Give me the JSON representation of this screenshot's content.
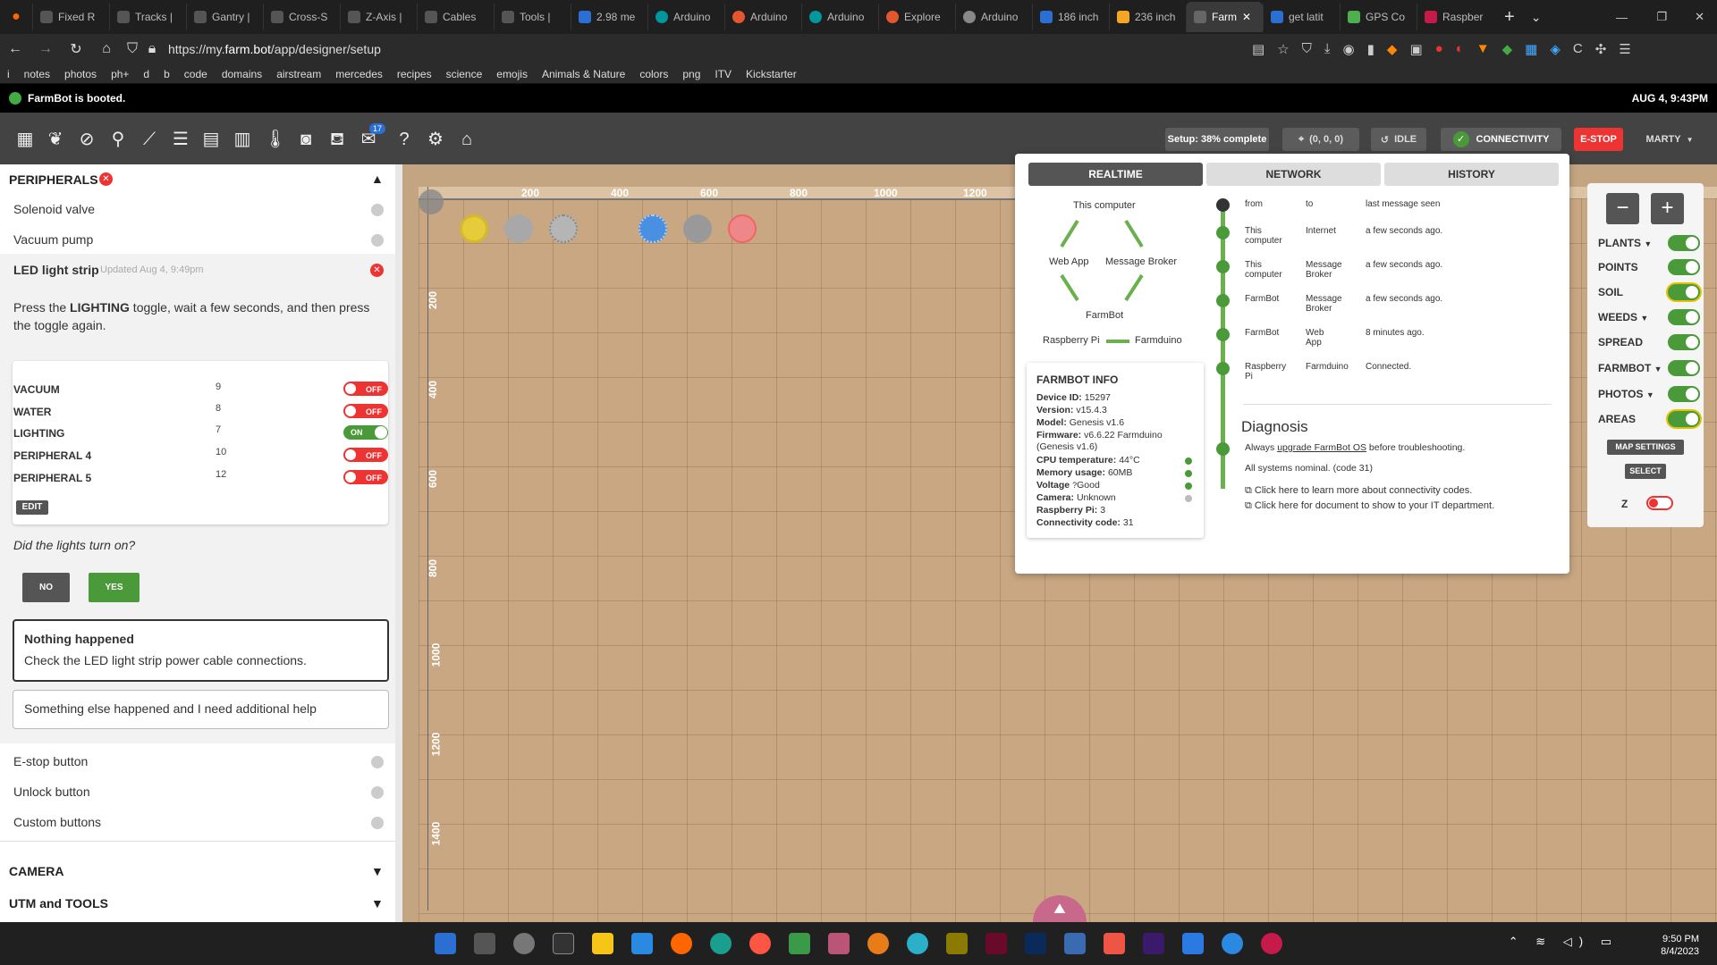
{
  "browser": {
    "tabs": [
      "Fixed R",
      "Tracks |",
      "Gantry |",
      "Cross-S",
      "Z-Axis |",
      "Cables",
      "Tools |",
      "2.98 me",
      "Arduino",
      "Arduino",
      "Arduino",
      "Explore",
      "Arduino",
      "186 inch",
      "236 inch",
      "Farm",
      "get latit",
      "GPS Co",
      "Raspber"
    ],
    "url_prefix": "https://my.",
    "url_domain": "farm.bot",
    "url_path": "/app/designer/setup",
    "bookmarks": [
      "i",
      "notes",
      "photos",
      "ph+",
      "d",
      "b",
      "code",
      "domains",
      "airstream",
      "mercedes",
      "recipes",
      "science",
      "emojis",
      "Animals & Nature",
      "colors",
      "png",
      "ITV",
      "Kickstarter"
    ]
  },
  "status": {
    "message": "FarmBot is booted.",
    "datetime": "AUG 4, 9:43PM"
  },
  "toolbar": {
    "setup": "Setup: 38% complete",
    "coords": "(0, 0, 0)",
    "idle": "IDLE",
    "connectivity": "CONNECTIVITY",
    "estop": "E-STOP",
    "user": "MARTY",
    "mail_badge": "17"
  },
  "left": {
    "peripherals_title": "PERIPHERALS",
    "items_top": [
      "Solenoid valve",
      "Vacuum pump"
    ],
    "led_title": "LED light strip",
    "led_updated": "Updated Aug 4, 9:49pm",
    "instruction_pre": "Press the ",
    "instruction_bold": "LIGHTING",
    "instruction_post": " toggle, wait a few seconds, and then press the toggle again.",
    "peripherals": [
      {
        "label": "VACUUM",
        "pin": "9",
        "state": "OFF"
      },
      {
        "label": "WATER",
        "pin": "8",
        "state": "OFF"
      },
      {
        "label": "LIGHTING",
        "pin": "7",
        "state": "ON"
      },
      {
        "label": "PERIPHERAL 4",
        "pin": "10",
        "state": "OFF"
      },
      {
        "label": "PERIPHERAL 5",
        "pin": "12",
        "state": "OFF"
      }
    ],
    "edit": "EDIT",
    "question": "Did the lights turn on?",
    "no": "NO",
    "yes": "YES",
    "nothing_title": "Nothing happened",
    "nothing_body": "Check the LED light strip power cable connections.",
    "something_else": "Something else happened and I need additional help",
    "items_bottom": [
      "E-stop button",
      "Unlock button",
      "Custom buttons"
    ],
    "camera": "CAMERA",
    "utm": "UTM and TOOLS"
  },
  "map": {
    "x_ticks": [
      "200",
      "400",
      "600",
      "800",
      "1000",
      "1200"
    ],
    "y_ticks": [
      "200",
      "400",
      "600",
      "800",
      "1000",
      "1200",
      "1400"
    ],
    "controls": {
      "zoom_out": "−",
      "zoom_in": "+",
      "layers": [
        {
          "label": "PLANTS",
          "dropdown": true
        },
        {
          "label": "POINTS",
          "dropdown": false
        },
        {
          "label": "SOIL",
          "dropdown": false
        },
        {
          "label": "WEEDS",
          "dropdown": true
        },
        {
          "label": "SPREAD",
          "dropdown": false
        },
        {
          "label": "FARMBOT",
          "dropdown": true
        },
        {
          "label": "PHOTOS",
          "dropdown": true
        },
        {
          "label": "AREAS",
          "dropdown": false
        }
      ],
      "map_settings": "MAP SETTINGS",
      "select": "SELECT",
      "z": "Z"
    }
  },
  "connectivity": {
    "tabs": [
      "REALTIME",
      "NETWORK",
      "HISTORY"
    ],
    "diagram": {
      "this_computer": "This computer",
      "web_app": "Web App",
      "message_broker": "Message Broker",
      "farmbot": "FarmBot",
      "raspberry_pi": "Raspberry Pi",
      "farmduino": "Farmduino"
    },
    "table_header": {
      "from": "from",
      "to": "to",
      "last": "last message seen"
    },
    "rows": [
      {
        "from": "This computer",
        "to": "Internet",
        "last": "a few seconds ago."
      },
      {
        "from": "This computer",
        "to": "Message Broker",
        "last": "a few seconds ago."
      },
      {
        "from": "FarmBot",
        "to": "Message Broker",
        "last": "a few seconds ago."
      },
      {
        "from": "FarmBot",
        "to": "Web App",
        "last": "8 minutes ago."
      },
      {
        "from": "Raspberry Pi",
        "to": "Farmduino",
        "last": "Connected."
      }
    ],
    "info_title": "FARMBOT INFO",
    "info": [
      {
        "k": "Device ID:",
        "v": "15297"
      },
      {
        "k": "Version:",
        "v": "v15.4.3"
      },
      {
        "k": "Model:",
        "v": "Genesis v1.6"
      },
      {
        "k": "Firmware:",
        "v": "v6.6.22 Farmduino (Genesis v1.6)"
      },
      {
        "k": "CPU temperature:",
        "v": "44°C"
      },
      {
        "k": "Memory usage:",
        "v": "60MB"
      },
      {
        "k": "Voltage",
        "v": "Good"
      },
      {
        "k": "Camera:",
        "v": "Unknown"
      },
      {
        "k": "Raspberry Pi:",
        "v": "3"
      },
      {
        "k": "Connectivity code:",
        "v": "31"
      }
    ],
    "diagnosis_title": "Diagnosis",
    "diag_pre": "Always ",
    "diag_link": "upgrade FarmBot OS",
    "diag_post": " before troubleshooting.",
    "nominal": "All systems nominal. (code 31)",
    "link1": "Click here to learn more about connectivity codes.",
    "link2": "Click here for document to show to your IT department."
  },
  "taskbar": {
    "time": "9:50 PM",
    "date": "8/4/2023"
  },
  "colors": {
    "green": "#4a9a3a",
    "red": "#e33333",
    "status_bar": "#000000",
    "nav_bg": "#434343",
    "soil": "#c9a783"
  }
}
